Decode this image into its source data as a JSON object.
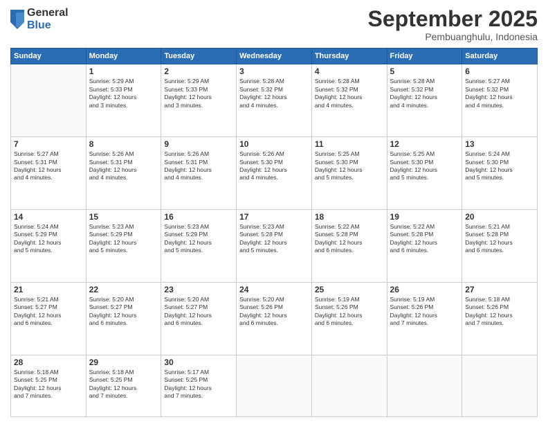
{
  "logo": {
    "general": "General",
    "blue": "Blue"
  },
  "header": {
    "month": "September 2025",
    "location": "Pembuanghulu, Indonesia"
  },
  "days": [
    "Sunday",
    "Monday",
    "Tuesday",
    "Wednesday",
    "Thursday",
    "Friday",
    "Saturday"
  ],
  "weeks": [
    [
      {
        "num": "",
        "lines": []
      },
      {
        "num": "1",
        "lines": [
          "Sunrise: 5:29 AM",
          "Sunset: 5:33 PM",
          "Daylight: 12 hours",
          "and 3 minutes."
        ]
      },
      {
        "num": "2",
        "lines": [
          "Sunrise: 5:29 AM",
          "Sunset: 5:33 PM",
          "Daylight: 12 hours",
          "and 3 minutes."
        ]
      },
      {
        "num": "3",
        "lines": [
          "Sunrise: 5:28 AM",
          "Sunset: 5:32 PM",
          "Daylight: 12 hours",
          "and 4 minutes."
        ]
      },
      {
        "num": "4",
        "lines": [
          "Sunrise: 5:28 AM",
          "Sunset: 5:32 PM",
          "Daylight: 12 hours",
          "and 4 minutes."
        ]
      },
      {
        "num": "5",
        "lines": [
          "Sunrise: 5:28 AM",
          "Sunset: 5:32 PM",
          "Daylight: 12 hours",
          "and 4 minutes."
        ]
      },
      {
        "num": "6",
        "lines": [
          "Sunrise: 5:27 AM",
          "Sunset: 5:32 PM",
          "Daylight: 12 hours",
          "and 4 minutes."
        ]
      }
    ],
    [
      {
        "num": "7",
        "lines": [
          "Sunrise: 5:27 AM",
          "Sunset: 5:31 PM",
          "Daylight: 12 hours",
          "and 4 minutes."
        ]
      },
      {
        "num": "8",
        "lines": [
          "Sunrise: 5:26 AM",
          "Sunset: 5:31 PM",
          "Daylight: 12 hours",
          "and 4 minutes."
        ]
      },
      {
        "num": "9",
        "lines": [
          "Sunrise: 5:26 AM",
          "Sunset: 5:31 PM",
          "Daylight: 12 hours",
          "and 4 minutes."
        ]
      },
      {
        "num": "10",
        "lines": [
          "Sunrise: 5:26 AM",
          "Sunset: 5:30 PM",
          "Daylight: 12 hours",
          "and 4 minutes."
        ]
      },
      {
        "num": "11",
        "lines": [
          "Sunrise: 5:25 AM",
          "Sunset: 5:30 PM",
          "Daylight: 12 hours",
          "and 5 minutes."
        ]
      },
      {
        "num": "12",
        "lines": [
          "Sunrise: 5:25 AM",
          "Sunset: 5:30 PM",
          "Daylight: 12 hours",
          "and 5 minutes."
        ]
      },
      {
        "num": "13",
        "lines": [
          "Sunrise: 5:24 AM",
          "Sunset: 5:30 PM",
          "Daylight: 12 hours",
          "and 5 minutes."
        ]
      }
    ],
    [
      {
        "num": "14",
        "lines": [
          "Sunrise: 5:24 AM",
          "Sunset: 5:29 PM",
          "Daylight: 12 hours",
          "and 5 minutes."
        ]
      },
      {
        "num": "15",
        "lines": [
          "Sunrise: 5:23 AM",
          "Sunset: 5:29 PM",
          "Daylight: 12 hours",
          "and 5 minutes."
        ]
      },
      {
        "num": "16",
        "lines": [
          "Sunrise: 5:23 AM",
          "Sunset: 5:29 PM",
          "Daylight: 12 hours",
          "and 5 minutes."
        ]
      },
      {
        "num": "17",
        "lines": [
          "Sunrise: 5:23 AM",
          "Sunset: 5:28 PM",
          "Daylight: 12 hours",
          "and 5 minutes."
        ]
      },
      {
        "num": "18",
        "lines": [
          "Sunrise: 5:22 AM",
          "Sunset: 5:28 PM",
          "Daylight: 12 hours",
          "and 6 minutes."
        ]
      },
      {
        "num": "19",
        "lines": [
          "Sunrise: 5:22 AM",
          "Sunset: 5:28 PM",
          "Daylight: 12 hours",
          "and 6 minutes."
        ]
      },
      {
        "num": "20",
        "lines": [
          "Sunrise: 5:21 AM",
          "Sunset: 5:28 PM",
          "Daylight: 12 hours",
          "and 6 minutes."
        ]
      }
    ],
    [
      {
        "num": "21",
        "lines": [
          "Sunrise: 5:21 AM",
          "Sunset: 5:27 PM",
          "Daylight: 12 hours",
          "and 6 minutes."
        ]
      },
      {
        "num": "22",
        "lines": [
          "Sunrise: 5:20 AM",
          "Sunset: 5:27 PM",
          "Daylight: 12 hours",
          "and 6 minutes."
        ]
      },
      {
        "num": "23",
        "lines": [
          "Sunrise: 5:20 AM",
          "Sunset: 5:27 PM",
          "Daylight: 12 hours",
          "and 6 minutes."
        ]
      },
      {
        "num": "24",
        "lines": [
          "Sunrise: 5:20 AM",
          "Sunset: 5:26 PM",
          "Daylight: 12 hours",
          "and 6 minutes."
        ]
      },
      {
        "num": "25",
        "lines": [
          "Sunrise: 5:19 AM",
          "Sunset: 5:26 PM",
          "Daylight: 12 hours",
          "and 6 minutes."
        ]
      },
      {
        "num": "26",
        "lines": [
          "Sunrise: 5:19 AM",
          "Sunset: 5:26 PM",
          "Daylight: 12 hours",
          "and 7 minutes."
        ]
      },
      {
        "num": "27",
        "lines": [
          "Sunrise: 5:18 AM",
          "Sunset: 5:26 PM",
          "Daylight: 12 hours",
          "and 7 minutes."
        ]
      }
    ],
    [
      {
        "num": "28",
        "lines": [
          "Sunrise: 5:18 AM",
          "Sunset: 5:25 PM",
          "Daylight: 12 hours",
          "and 7 minutes."
        ]
      },
      {
        "num": "29",
        "lines": [
          "Sunrise: 5:18 AM",
          "Sunset: 5:25 PM",
          "Daylight: 12 hours",
          "and 7 minutes."
        ]
      },
      {
        "num": "30",
        "lines": [
          "Sunrise: 5:17 AM",
          "Sunset: 5:25 PM",
          "Daylight: 12 hours",
          "and 7 minutes."
        ]
      },
      {
        "num": "",
        "lines": []
      },
      {
        "num": "",
        "lines": []
      },
      {
        "num": "",
        "lines": []
      },
      {
        "num": "",
        "lines": []
      }
    ]
  ]
}
